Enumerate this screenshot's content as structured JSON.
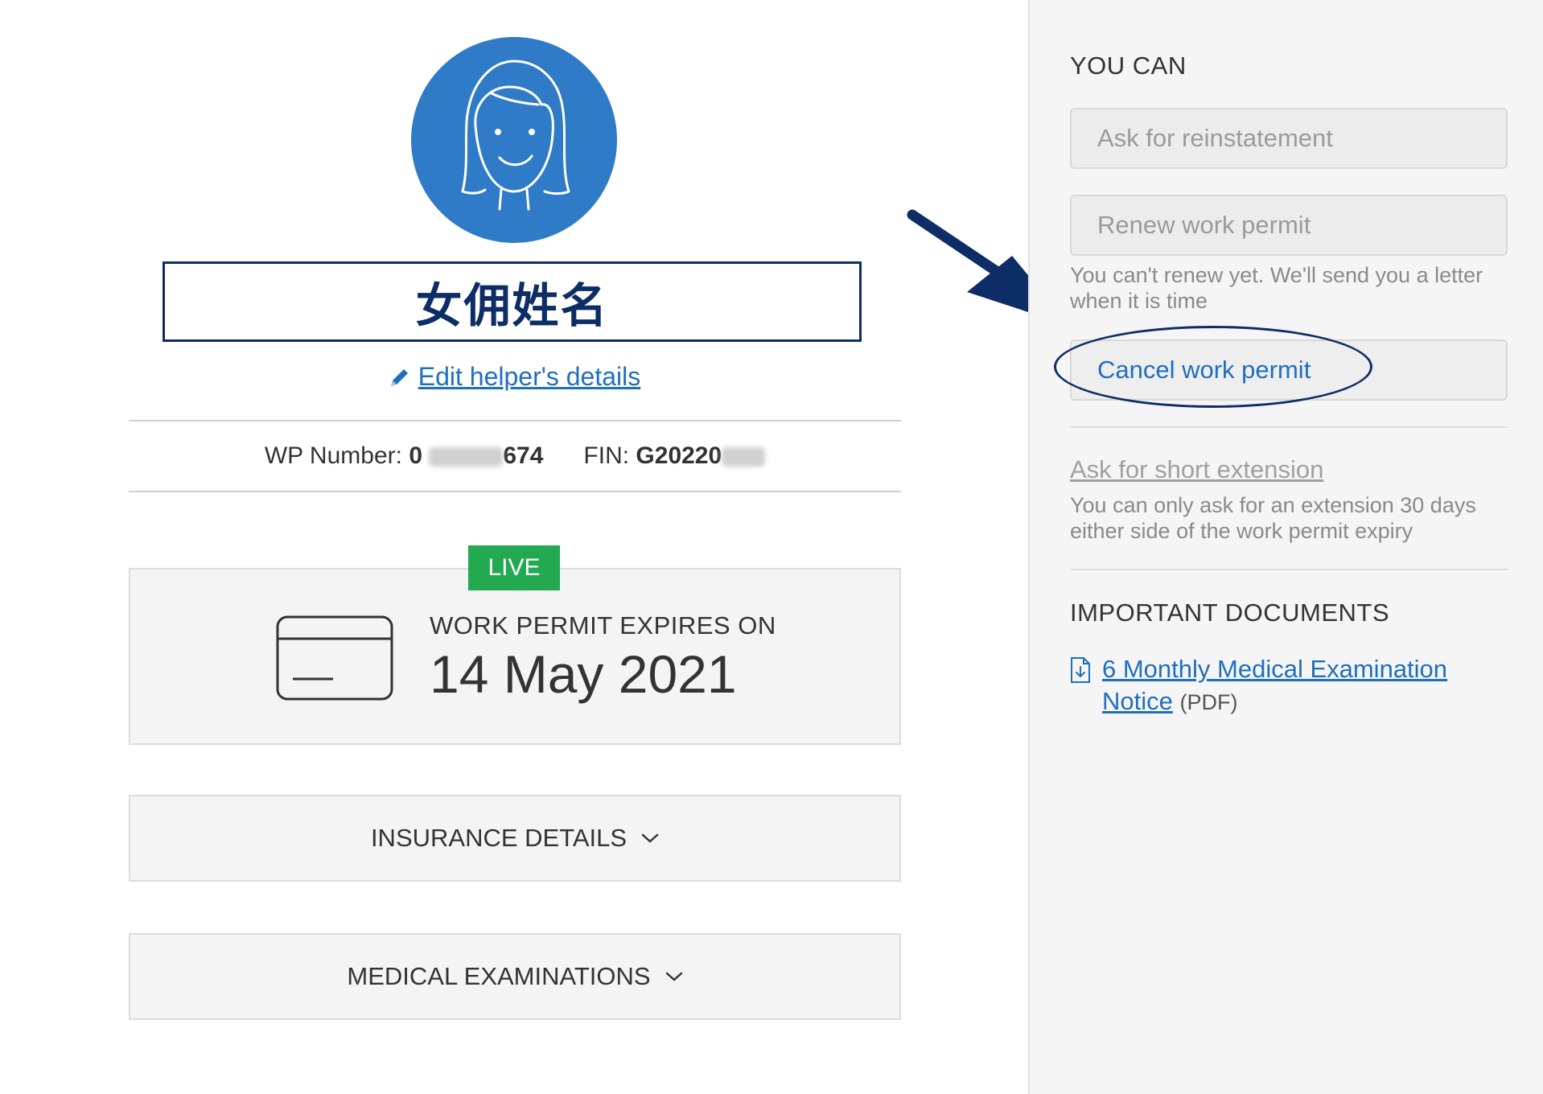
{
  "profile": {
    "helper_name": "女佣姓名",
    "edit_link": "Edit helper's details"
  },
  "identity": {
    "wp_label": "WP Number:",
    "wp_prefix": "0",
    "wp_suffix": "674",
    "fin_label": "FIN:",
    "fin_prefix": "G20220"
  },
  "permit": {
    "status_badge": "LIVE",
    "expires_label": "WORK PERMIT EXPIRES ON",
    "expires_date": "14 May 2021"
  },
  "accordions": {
    "insurance": "INSURANCE DETAILS",
    "medical": "MEDICAL EXAMINATIONS"
  },
  "sidebar": {
    "you_can_title": "YOU CAN",
    "reinstatement_button": "Ask for reinstatement",
    "renew_button": "Renew work permit",
    "renew_hint": "You can't renew yet. We'll send you a letter when it is time",
    "cancel_button": "Cancel work permit",
    "short_extension_link": "Ask for short extension",
    "short_extension_hint": "You can only ask for an extension 30 days either side of the work permit expiry",
    "documents_title": "IMPORTANT DOCUMENTS",
    "document_link": "6 Monthly Medical Examination Notice",
    "document_ext": "(PDF)"
  },
  "colors": {
    "link_blue": "#1f6fbf",
    "avatar_blue": "#2f7bc7",
    "annotation_navy": "#0d2d66",
    "live_green": "#23a94f"
  }
}
